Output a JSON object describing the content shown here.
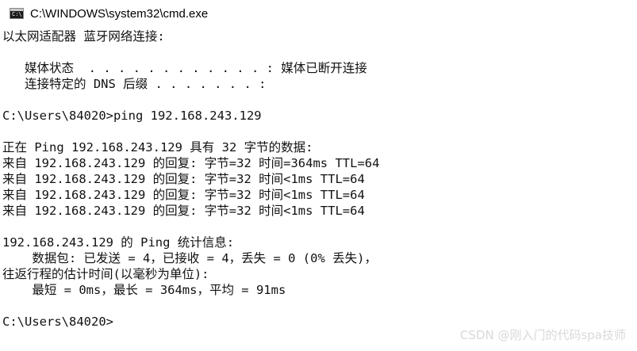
{
  "window": {
    "title": "C:\\WINDOWS\\system32\\cmd.exe",
    "icon": "cmd-console-icon",
    "icon_prompt": "C:\\"
  },
  "console": {
    "lines": [
      "以太网适配器 蓝牙网络连接:",
      "",
      "   媒体状态  . . . . . . . . . . . . : 媒体已断开连接",
      "   连接特定的 DNS 后缀 . . . . . . . :",
      "",
      "C:\\Users\\84020>ping 192.168.243.129",
      "",
      "正在 Ping 192.168.243.129 具有 32 字节的数据:",
      "来自 192.168.243.129 的回复: 字节=32 时间=364ms TTL=64",
      "来自 192.168.243.129 的回复: 字节=32 时间<1ms TTL=64",
      "来自 192.168.243.129 的回复: 字节=32 时间<1ms TTL=64",
      "来自 192.168.243.129 的回复: 字节=32 时间<1ms TTL=64",
      "",
      "192.168.243.129 的 Ping 统计信息:",
      "    数据包: 已发送 = 4，已接收 = 4，丢失 = 0 (0% 丢失)，",
      "往返行程的估计时间(以毫秒为单位):",
      "    最短 = 0ms，最长 = 364ms，平均 = 91ms",
      "",
      "C:\\Users\\84020>"
    ]
  },
  "watermark": "CSDN @刚入门的代码spa技师",
  "colors": {
    "background": "#ffffff",
    "text": "#111111",
    "watermark": "#d9d9d9"
  }
}
